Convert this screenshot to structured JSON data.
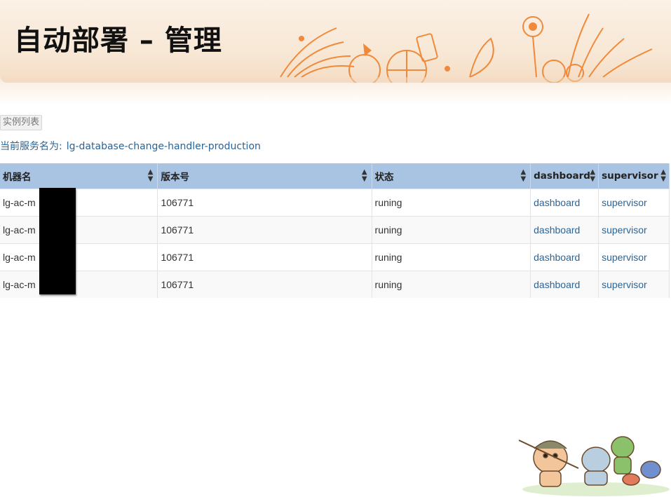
{
  "slide": {
    "title": "自动部署 – 管理"
  },
  "toolbar": {
    "instance_list_label": "实例列表"
  },
  "service": {
    "prefix": "当前服务名为:",
    "name": "lg-database-change-handler-production"
  },
  "table": {
    "columns": [
      "机器名",
      "版本号",
      "状态",
      "dashboard",
      "supervisor"
    ],
    "rows": [
      {
        "host": "lg-ac-m",
        "version": "106771",
        "status": "runing",
        "dashboard": "dashboard",
        "supervisor": "supervisor"
      },
      {
        "host": "lg-ac-m",
        "version": "106771",
        "status": "runing",
        "dashboard": "dashboard",
        "supervisor": "supervisor"
      },
      {
        "host": "lg-ac-m",
        "version": "106771",
        "status": "runing",
        "dashboard": "dashboard",
        "supervisor": "supervisor"
      },
      {
        "host": "lg-ac-m",
        "version": "106771",
        "status": "runing",
        "dashboard": "dashboard",
        "supervisor": "supervisor"
      }
    ]
  },
  "icons": {
    "sort": "sort-icon"
  },
  "colors": {
    "header_bg": "#a9c3e3",
    "link": "#2a6496",
    "banner": "#f7e6d3",
    "decor": "#f08a3a"
  }
}
